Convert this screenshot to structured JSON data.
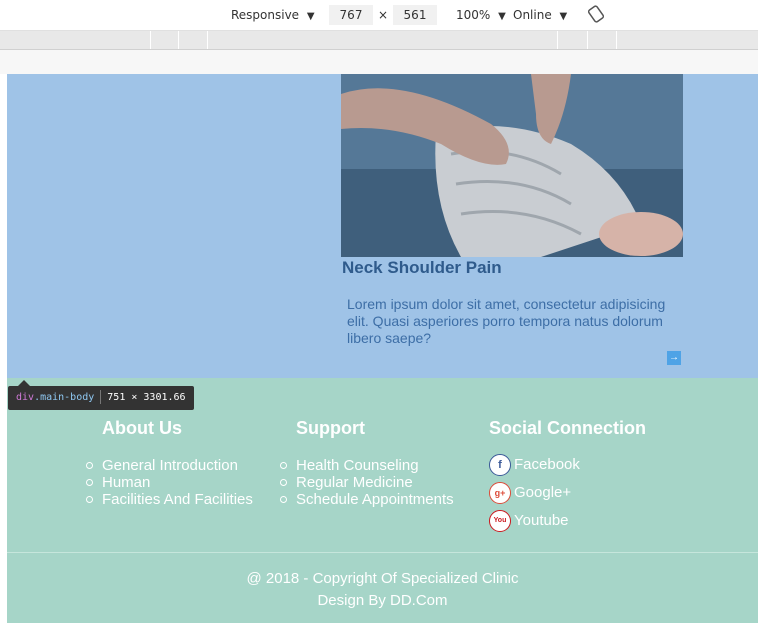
{
  "devtools": {
    "device_mode": "Responsive",
    "width": "767",
    "times": "×",
    "height": "561",
    "zoom": "100%",
    "network": "Online",
    "rotate_icon": "rotate-icon"
  },
  "card": {
    "title": "Neck Shoulder Pain",
    "text_lines": [
      "Lorem ipsum dolor sit amet, consectetur adipisicing",
      "elit. Quasi asperiores porro tempora natus dolorum",
      "libero saepe?"
    ],
    "more_icon": "arrow-right-icon"
  },
  "tooltip": {
    "tag": "div",
    "cls": ".main-body",
    "size": "751 × 3301.66"
  },
  "footer": {
    "about": {
      "heading": "About Us",
      "items": [
        "General Introduction",
        "Human",
        "Facilities And Facilities"
      ]
    },
    "support": {
      "heading": "Support",
      "items": [
        "Health Counseling",
        "Regular Medicine",
        "Schedule Appointments"
      ]
    },
    "social": {
      "heading": "Social Connection",
      "items": [
        {
          "label": "Facebook",
          "icon": "facebook-icon",
          "glyph": "f",
          "color": "#3b5998"
        },
        {
          "label": "Google+",
          "icon": "google-plus-icon",
          "glyph": "g+",
          "color": "#dd4b39"
        },
        {
          "label": "Youtube",
          "icon": "youtube-icon",
          "glyph": "You",
          "color": "#cc181e"
        }
      ]
    },
    "copyright": "@ 2018 - Copyright Of Specialized Clinic",
    "design": "Design By DD.Com"
  },
  "colors": {
    "main_body": "#9fc3e7",
    "footer": "#a6d5c8",
    "card_title": "#2f5b8c"
  }
}
